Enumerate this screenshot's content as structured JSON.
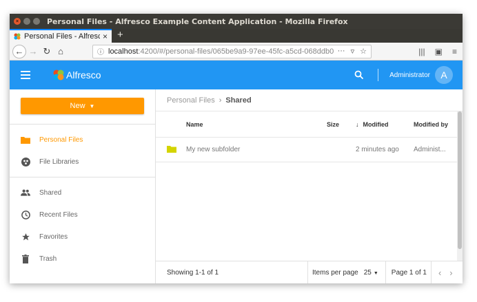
{
  "window": {
    "title": "Personal Files - Alfresco Example Content Application - Mozilla Firefox"
  },
  "browser": {
    "tab_label": "Personal Files - Alfresco",
    "url_host": "localhost",
    "url_rest": ":4200/#/personal-files/065be9a9-97ee-45fc-a5cd-068ddb0"
  },
  "header": {
    "logo_text": "Alfresco",
    "user_name": "Administrator",
    "avatar_initial": "A",
    "brand_color": "#2196f3"
  },
  "sidebar": {
    "new_button_label": "New",
    "items": [
      {
        "label": "Personal Files",
        "icon": "folder-icon",
        "active": true
      },
      {
        "label": "File Libraries",
        "icon": "libraries-icon",
        "active": false
      },
      {
        "label": "Shared",
        "icon": "people-icon",
        "active": false
      },
      {
        "label": "Recent Files",
        "icon": "clock-icon",
        "active": false
      },
      {
        "label": "Favorites",
        "icon": "star-icon",
        "active": false
      },
      {
        "label": "Trash",
        "icon": "trash-icon",
        "active": false
      }
    ]
  },
  "breadcrumb": {
    "root": "Personal Files",
    "current": "Shared"
  },
  "table": {
    "columns": {
      "name": "Name",
      "size": "Size",
      "modified": "Modified",
      "modified_by": "Modified by"
    },
    "rows": [
      {
        "name": "My new subfolder",
        "size": "",
        "modified": "2 minutes ago",
        "modified_by": "Administ..."
      }
    ]
  },
  "pagination": {
    "showing": "Showing 1-1 of 1",
    "per_page_label": "Items per page",
    "per_page_value": "25",
    "page_label": "Page 1 of 1"
  }
}
